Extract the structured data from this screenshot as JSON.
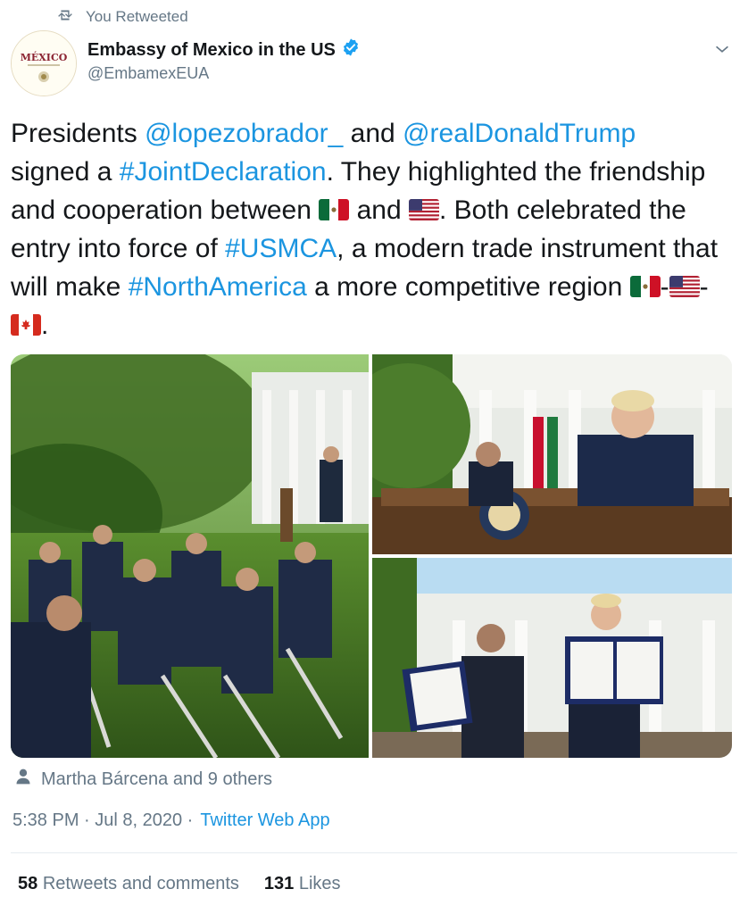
{
  "retweet_banner": {
    "icon": "retweet-icon",
    "text": "You Retweeted"
  },
  "author": {
    "name": "Embassy of Mexico in the US",
    "handle": "@EmbamexEUA",
    "verified_icon": "verified-badge-icon",
    "avatar_logo_text": "MÉXICO"
  },
  "tweet": {
    "t1": "Presidents ",
    "mention1": "@lopezobrador_",
    "t2": " and ",
    "mention2": "@realDonaldTrump",
    "t3": "signed a ",
    "hashtag1": "#JointDeclaration",
    "t4": ". They highlighted the friendship and cooperation between ",
    "t5": " and ",
    "t6": ". Both celebrated the entry into force of ",
    "hashtag2": "#USMCA",
    "t7": ", a modern trade instrument that will make ",
    "hashtag3": "#NorthAmerica",
    "t8": " a more competitive region ",
    "sep1": "-",
    "sep2": "-",
    "t9": "."
  },
  "liked_by": {
    "icon": "person-icon",
    "text": "Martha Bárcena and 9 others"
  },
  "meta": {
    "time": "5:38 PM · Jul 8, 2020 ·",
    "source": "Twitter Web App"
  },
  "stats": {
    "retweets_count": "58",
    "retweets_label": "Retweets and comments",
    "likes_count": "131",
    "likes_label": "Likes"
  },
  "colors": {
    "link": "#1b95e0",
    "secondary": "#657786",
    "verified": "#1da1f2"
  }
}
